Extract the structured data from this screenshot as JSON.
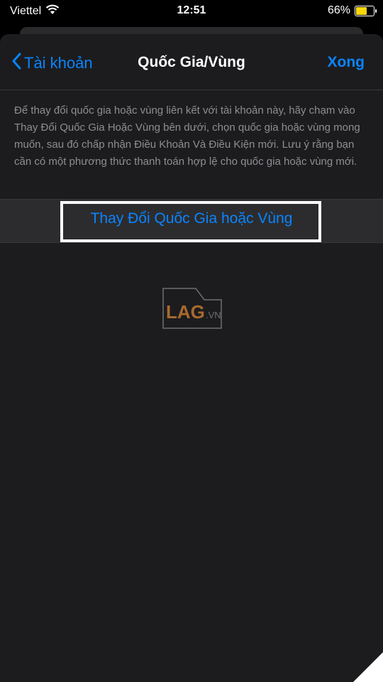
{
  "status_bar": {
    "carrier": "Viettel",
    "time": "12:51",
    "battery_percent": "66%",
    "battery_level": 0.66,
    "battery_color": "#ffd60a"
  },
  "nav": {
    "back_label": "Tài khoản",
    "title": "Quốc Gia/Vùng",
    "done_label": "Xong"
  },
  "content": {
    "description": "Để thay đổi quốc gia hoặc vùng liên kết với tài khoản này, hãy chạm vào Thay Đổi Quốc Gia Hoặc Vùng bên dưới, chọn quốc gia hoặc vùng mong muốn, sau đó chấp nhận Điều Khoản Và Điều Kiện mới. Lưu ý rằng bạn cần có một phương thức thanh toán hợp lệ cho quốc gia hoặc vùng mới.",
    "change_button_label": "Thay Đổi Quốc Gia hoặc Vùng"
  },
  "watermark": {
    "text": "LAG.VN"
  },
  "colors": {
    "accent": "#0a84ff",
    "background": "#1c1c1e",
    "row_background": "#2c2c2e",
    "secondary_text": "#8e8e93"
  }
}
